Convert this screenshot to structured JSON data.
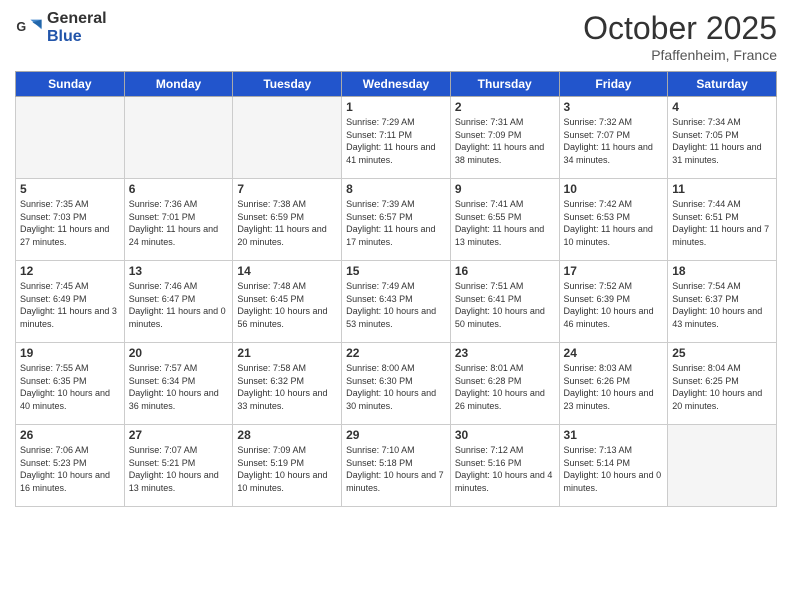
{
  "logo": {
    "general": "General",
    "blue": "Blue"
  },
  "title": "October 2025",
  "location": "Pfaffenheim, France",
  "days_of_week": [
    "Sunday",
    "Monday",
    "Tuesday",
    "Wednesday",
    "Thursday",
    "Friday",
    "Saturday"
  ],
  "weeks": [
    [
      {
        "day": "",
        "info": ""
      },
      {
        "day": "",
        "info": ""
      },
      {
        "day": "",
        "info": ""
      },
      {
        "day": "1",
        "info": "Sunrise: 7:29 AM\nSunset: 7:11 PM\nDaylight: 11 hours and 41 minutes."
      },
      {
        "day": "2",
        "info": "Sunrise: 7:31 AM\nSunset: 7:09 PM\nDaylight: 11 hours and 38 minutes."
      },
      {
        "day": "3",
        "info": "Sunrise: 7:32 AM\nSunset: 7:07 PM\nDaylight: 11 hours and 34 minutes."
      },
      {
        "day": "4",
        "info": "Sunrise: 7:34 AM\nSunset: 7:05 PM\nDaylight: 11 hours and 31 minutes."
      }
    ],
    [
      {
        "day": "5",
        "info": "Sunrise: 7:35 AM\nSunset: 7:03 PM\nDaylight: 11 hours and 27 minutes."
      },
      {
        "day": "6",
        "info": "Sunrise: 7:36 AM\nSunset: 7:01 PM\nDaylight: 11 hours and 24 minutes."
      },
      {
        "day": "7",
        "info": "Sunrise: 7:38 AM\nSunset: 6:59 PM\nDaylight: 11 hours and 20 minutes."
      },
      {
        "day": "8",
        "info": "Sunrise: 7:39 AM\nSunset: 6:57 PM\nDaylight: 11 hours and 17 minutes."
      },
      {
        "day": "9",
        "info": "Sunrise: 7:41 AM\nSunset: 6:55 PM\nDaylight: 11 hours and 13 minutes."
      },
      {
        "day": "10",
        "info": "Sunrise: 7:42 AM\nSunset: 6:53 PM\nDaylight: 11 hours and 10 minutes."
      },
      {
        "day": "11",
        "info": "Sunrise: 7:44 AM\nSunset: 6:51 PM\nDaylight: 11 hours and 7 minutes."
      }
    ],
    [
      {
        "day": "12",
        "info": "Sunrise: 7:45 AM\nSunset: 6:49 PM\nDaylight: 11 hours and 3 minutes."
      },
      {
        "day": "13",
        "info": "Sunrise: 7:46 AM\nSunset: 6:47 PM\nDaylight: 11 hours and 0 minutes."
      },
      {
        "day": "14",
        "info": "Sunrise: 7:48 AM\nSunset: 6:45 PM\nDaylight: 10 hours and 56 minutes."
      },
      {
        "day": "15",
        "info": "Sunrise: 7:49 AM\nSunset: 6:43 PM\nDaylight: 10 hours and 53 minutes."
      },
      {
        "day": "16",
        "info": "Sunrise: 7:51 AM\nSunset: 6:41 PM\nDaylight: 10 hours and 50 minutes."
      },
      {
        "day": "17",
        "info": "Sunrise: 7:52 AM\nSunset: 6:39 PM\nDaylight: 10 hours and 46 minutes."
      },
      {
        "day": "18",
        "info": "Sunrise: 7:54 AM\nSunset: 6:37 PM\nDaylight: 10 hours and 43 minutes."
      }
    ],
    [
      {
        "day": "19",
        "info": "Sunrise: 7:55 AM\nSunset: 6:35 PM\nDaylight: 10 hours and 40 minutes."
      },
      {
        "day": "20",
        "info": "Sunrise: 7:57 AM\nSunset: 6:34 PM\nDaylight: 10 hours and 36 minutes."
      },
      {
        "day": "21",
        "info": "Sunrise: 7:58 AM\nSunset: 6:32 PM\nDaylight: 10 hours and 33 minutes."
      },
      {
        "day": "22",
        "info": "Sunrise: 8:00 AM\nSunset: 6:30 PM\nDaylight: 10 hours and 30 minutes."
      },
      {
        "day": "23",
        "info": "Sunrise: 8:01 AM\nSunset: 6:28 PM\nDaylight: 10 hours and 26 minutes."
      },
      {
        "day": "24",
        "info": "Sunrise: 8:03 AM\nSunset: 6:26 PM\nDaylight: 10 hours and 23 minutes."
      },
      {
        "day": "25",
        "info": "Sunrise: 8:04 AM\nSunset: 6:25 PM\nDaylight: 10 hours and 20 minutes."
      }
    ],
    [
      {
        "day": "26",
        "info": "Sunrise: 7:06 AM\nSunset: 5:23 PM\nDaylight: 10 hours and 16 minutes."
      },
      {
        "day": "27",
        "info": "Sunrise: 7:07 AM\nSunset: 5:21 PM\nDaylight: 10 hours and 13 minutes."
      },
      {
        "day": "28",
        "info": "Sunrise: 7:09 AM\nSunset: 5:19 PM\nDaylight: 10 hours and 10 minutes."
      },
      {
        "day": "29",
        "info": "Sunrise: 7:10 AM\nSunset: 5:18 PM\nDaylight: 10 hours and 7 minutes."
      },
      {
        "day": "30",
        "info": "Sunrise: 7:12 AM\nSunset: 5:16 PM\nDaylight: 10 hours and 4 minutes."
      },
      {
        "day": "31",
        "info": "Sunrise: 7:13 AM\nSunset: 5:14 PM\nDaylight: 10 hours and 0 minutes."
      },
      {
        "day": "",
        "info": ""
      }
    ]
  ]
}
